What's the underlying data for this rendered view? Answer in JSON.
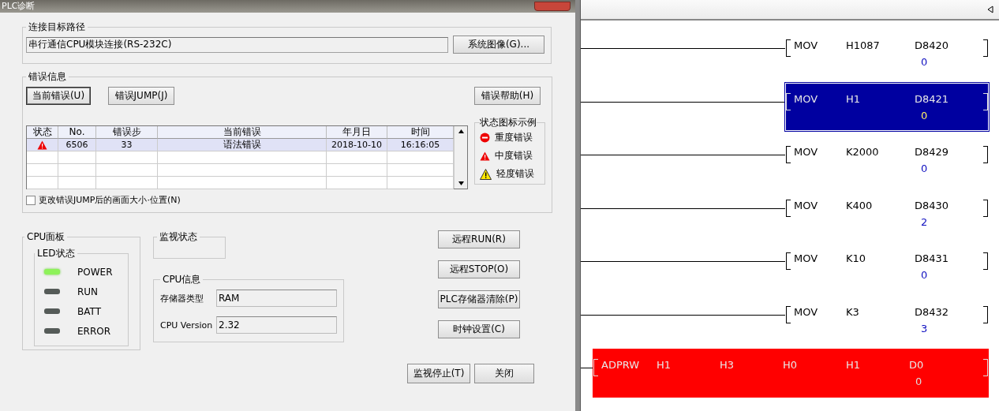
{
  "dialog": {
    "title": "PLC诊断",
    "connection": {
      "legend": "连接目标路径",
      "path": "串行通信CPU模块连接(RS-232C)",
      "button": "系统图像(G)..."
    },
    "errors": {
      "legend": "错误信息",
      "buttons": [
        {
          "label": "当前错误(U)",
          "selected": true
        },
        {
          "label": "错误JUMP(J)",
          "selected": false
        }
      ],
      "help_button": "错误帮助(H)",
      "table": {
        "columns": [
          "状态",
          "No.",
          "错误步",
          "当前错误",
          "年月日",
          "时间"
        ],
        "rows": [
          {
            "kind": "moderate",
            "no": "6506",
            "step": "33",
            "error": "语法错误",
            "date": "2018-10-10",
            "time": "16:16:05",
            "selected": true
          }
        ]
      },
      "icon_legend": {
        "title": "状态图标示例",
        "items": [
          {
            "kind": "severe",
            "label": "重度错误"
          },
          {
            "kind": "moderate",
            "label": "中度错误"
          },
          {
            "kind": "minor",
            "label": "轻度错误"
          }
        ]
      },
      "checkbox": {
        "label": "更改错误JUMP后的画面大小·位置(N)",
        "checked": false
      }
    },
    "cpu_panel": {
      "legend": "CPU面板",
      "led_legend": "LED状态",
      "leds": [
        {
          "label": "POWER",
          "on": true
        },
        {
          "label": "RUN",
          "on": false
        },
        {
          "label": "BATT",
          "on": false
        },
        {
          "label": "ERROR",
          "on": false
        }
      ]
    },
    "monitor": {
      "legend": "监视状态"
    },
    "cpu_info": {
      "legend": "CPU信息",
      "fields": [
        {
          "label": "存储器类型",
          "value": "RAM"
        },
        {
          "label": "CPU Version",
          "value": "2.32"
        }
      ]
    },
    "side_buttons": [
      "远程RUN(R)",
      "远程STOP(O)",
      "PLC存储器清除(P)",
      "时钟设置(C)"
    ],
    "footer_buttons": [
      "监视停止(T)",
      "关闭"
    ]
  },
  "ladder": {
    "rungs": [
      {
        "instruction": "MOV",
        "operands": [
          "H1087",
          "D8420"
        ],
        "value": "0",
        "selected": false,
        "error": false
      },
      {
        "instruction": "MOV",
        "operands": [
          "H1",
          "D8421"
        ],
        "value": "0",
        "selected": true,
        "error": false
      },
      {
        "instruction": "MOV",
        "operands": [
          "K2000",
          "D8429"
        ],
        "value": "0",
        "selected": false,
        "error": false
      },
      {
        "instruction": "MOV",
        "operands": [
          "K400",
          "D8430"
        ],
        "value": "2",
        "selected": false,
        "error": false
      },
      {
        "instruction": "MOV",
        "operands": [
          "K10",
          "D8431"
        ],
        "value": "0",
        "selected": false,
        "error": false
      },
      {
        "instruction": "MOV",
        "operands": [
          "K3",
          "D8432"
        ],
        "value": "3",
        "selected": false,
        "error": false
      },
      {
        "instruction": "ADPRW",
        "operands": [
          "H1",
          "H3",
          "H0",
          "H1",
          "D0"
        ],
        "value": "0",
        "selected": false,
        "error": true
      }
    ]
  }
}
